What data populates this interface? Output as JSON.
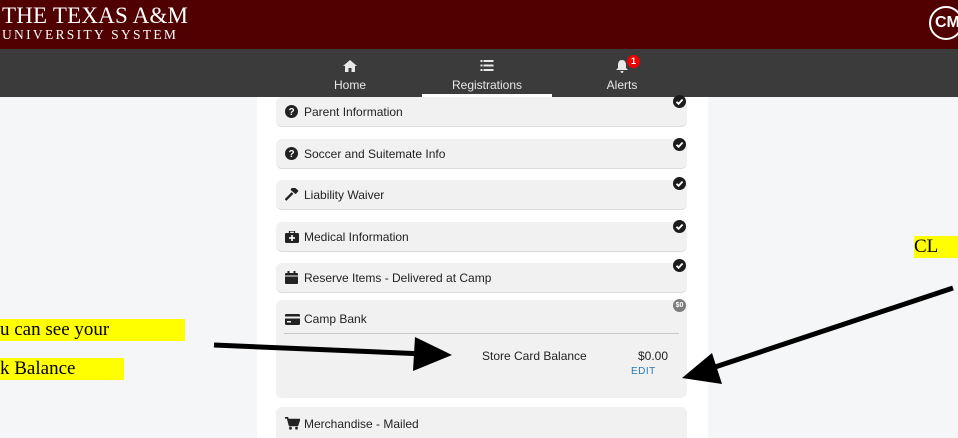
{
  "header": {
    "brand_line1": "THE TEXAS A&M",
    "brand_line2": "UNIVERSITY SYSTEM",
    "avatar_initials": "CM",
    "brand_color": "#500000"
  },
  "nav": {
    "tabs": [
      {
        "label": "Home",
        "icon": "home-icon"
      },
      {
        "label": "Registrations",
        "icon": "list-icon",
        "active": true
      },
      {
        "label": "Alerts",
        "icon": "bell-icon",
        "badge": "1"
      }
    ]
  },
  "sections": [
    {
      "title": "Parent Information",
      "icon": "question-circle-icon",
      "status": "check-icon"
    },
    {
      "title": "Soccer and Suitemate Info",
      "icon": "question-circle-icon",
      "status": "check-icon"
    },
    {
      "title": "Liability Waiver",
      "icon": "gavel-icon",
      "status": "check-icon"
    },
    {
      "title": "Medical Information",
      "icon": "medkit-icon",
      "status": "check-icon"
    },
    {
      "title": "Reserve Items - Delivered at Camp",
      "icon": "calendar-icon",
      "status": "check-icon"
    },
    {
      "title": "Camp Bank",
      "icon": "credit-card-icon",
      "status_text": "$0"
    },
    {
      "title": "Merchandise - Mailed",
      "icon": "cart-icon"
    }
  ],
  "camp_bank": {
    "balance_label": "Store Card Balance",
    "balance_value": "$0.00",
    "edit_label": "EDIT"
  },
  "annotations": {
    "left_line1": "u can see your",
    "left_line2": "k Balance",
    "right": "CL",
    "highlight_color": "#ffff00"
  }
}
